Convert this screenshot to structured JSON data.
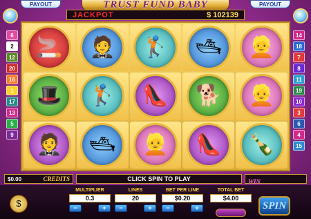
{
  "header": {
    "title": "TRUST FUND BABY",
    "payout_left": "PAYOUT",
    "payout_right": "PAYOUT",
    "jackpot_label": "JACKPOT",
    "jackpot_value": "$ 102139"
  },
  "reels": [
    [
      {
        "symbol": "smoking-man",
        "glyph": "🚬",
        "bg": "bg-red"
      },
      {
        "symbol": "butler",
        "glyph": "🤵",
        "bg": "bg-blue"
      },
      {
        "symbol": "golfer",
        "glyph": "🏌",
        "bg": "bg-teal"
      },
      {
        "symbol": "yacht",
        "glyph": "🛥",
        "bg": "bg-blue"
      },
      {
        "symbol": "blonde-woman",
        "glyph": "👱",
        "bg": "bg-pink"
      }
    ],
    [
      {
        "symbol": "tuxedo",
        "glyph": "🎩",
        "bg": "bg-green"
      },
      {
        "symbol": "golfer",
        "glyph": "🏌",
        "bg": "bg-teal"
      },
      {
        "symbol": "high-heel",
        "glyph": "👠",
        "bg": "bg-purple"
      },
      {
        "symbol": "chihuahua",
        "glyph": "🐕",
        "bg": "bg-green"
      },
      {
        "symbol": "blonde-woman",
        "glyph": "👱",
        "bg": "bg-pink"
      }
    ],
    [
      {
        "symbol": "butler",
        "glyph": "🤵",
        "bg": "bg-purple"
      },
      {
        "symbol": "yacht",
        "glyph": "🛥",
        "bg": "bg-blue"
      },
      {
        "symbol": "blonde-woman",
        "glyph": "👱",
        "bg": "bg-pink"
      },
      {
        "symbol": "high-heel",
        "glyph": "👠",
        "bg": "bg-purple"
      },
      {
        "symbol": "champagne",
        "glyph": "🍾",
        "bg": "bg-teal"
      }
    ]
  ],
  "lines_left": [
    "6",
    "2",
    "12",
    "20",
    "16",
    "1",
    "17",
    "13",
    "5",
    "9"
  ],
  "lines_right": [
    "14",
    "18",
    "7",
    "8",
    "11",
    "19",
    "10",
    "3",
    "6",
    "4",
    "15"
  ],
  "line_colors_left": [
    "#e04aa0",
    "#ffffff",
    "#5a8a2a",
    "#d02a2a",
    "#ff7a2a",
    "#ffd02a",
    "#2a8a8a",
    "#d02a8a",
    "#2ab04a",
    "#7a2a9a"
  ],
  "line_colors_right": [
    "#d02a8a",
    "#2a6ad0",
    "#e03a3a",
    "#6a2ad0",
    "#2aa0d0",
    "#2a8a4a",
    "#8a2ad0",
    "#e03a3a",
    "#2a5ab0",
    "#d02a8a",
    "#2a8ad0"
  ],
  "message": "CLICK SPIN TO PLAY",
  "credits": {
    "value": "$0.00",
    "label": "CREDITS"
  },
  "win": {
    "label": "WIN"
  },
  "controls": {
    "multiplier": {
      "label": "MULTIPLIER",
      "value": "0.3"
    },
    "lines": {
      "label": "LINES",
      "value": "20"
    },
    "bet_per_line": {
      "label": "BET PER LINE",
      "value": "$0.20"
    },
    "total_bet": {
      "label": "TOTAL BET",
      "value": "$4.00"
    },
    "minus": "−",
    "plus": "+",
    "spin_label": "SPIN"
  }
}
